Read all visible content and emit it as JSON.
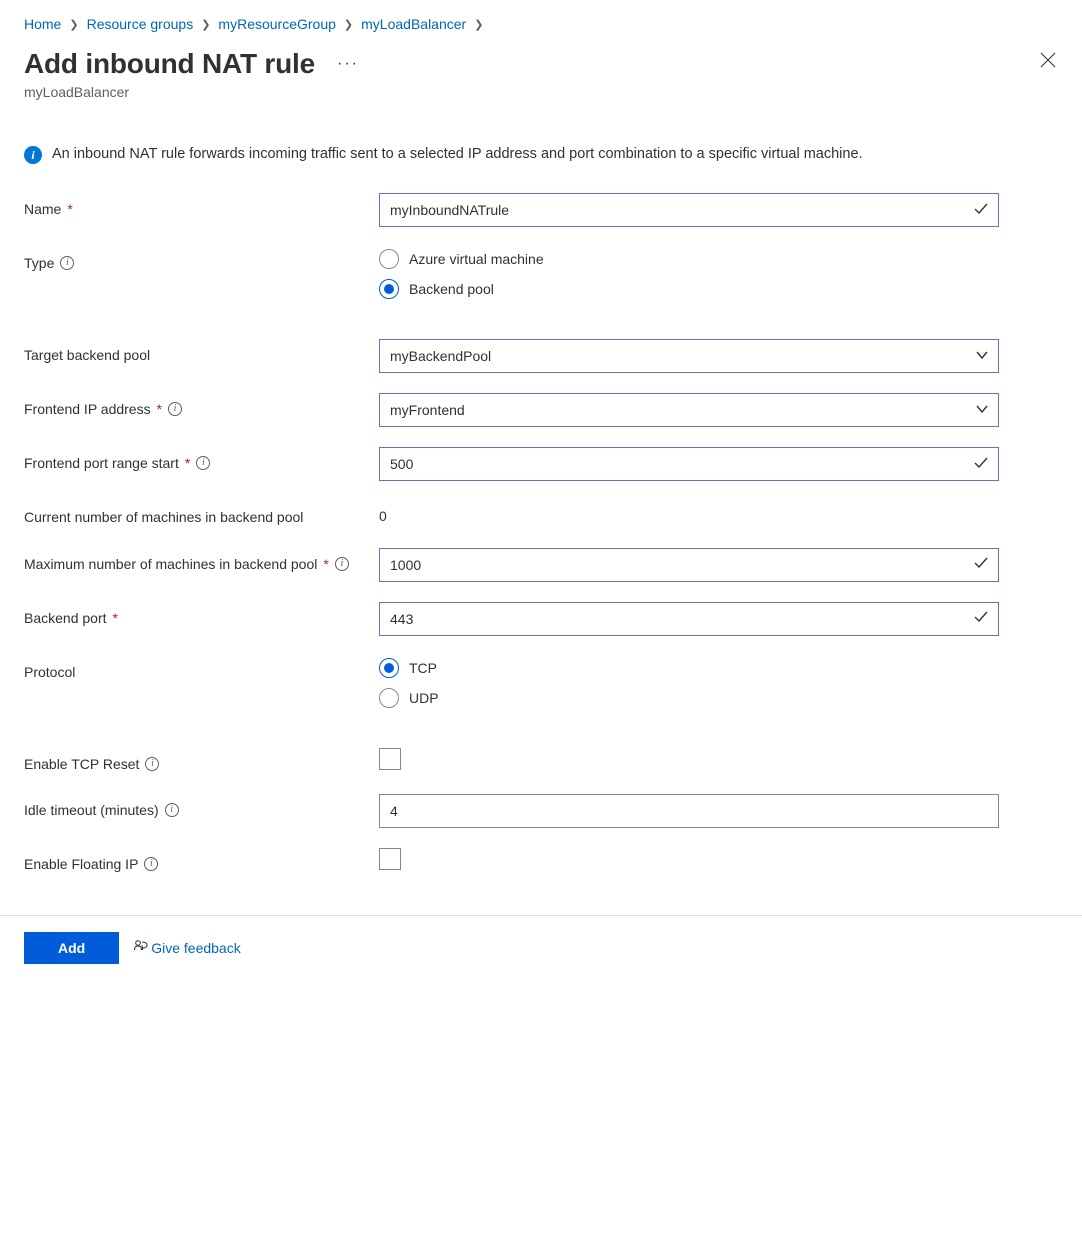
{
  "breadcrumb": {
    "items": [
      "Home",
      "Resource groups",
      "myResourceGroup",
      "myLoadBalancer"
    ]
  },
  "header": {
    "title": "Add inbound NAT rule",
    "subtitle": "myLoadBalancer"
  },
  "info": {
    "text": "An inbound NAT rule forwards incoming traffic sent to a selected IP address and port combination to a specific virtual machine."
  },
  "form": {
    "name": {
      "label": "Name",
      "value": "myInboundNATrule"
    },
    "type": {
      "label": "Type",
      "options": [
        "Azure virtual machine",
        "Backend pool"
      ],
      "selected": 1
    },
    "targetBackendPool": {
      "label": "Target backend pool",
      "value": "myBackendPool"
    },
    "frontendIp": {
      "label": "Frontend IP address",
      "value": "myFrontend"
    },
    "frontendPortStart": {
      "label": "Frontend port range start",
      "value": "500"
    },
    "currentMachines": {
      "label": "Current number of machines in backend pool",
      "value": "0"
    },
    "maxMachines": {
      "label": "Maximum number of machines in backend pool",
      "value": "1000"
    },
    "backendPort": {
      "label": "Backend port",
      "value": "443"
    },
    "protocol": {
      "label": "Protocol",
      "options": [
        "TCP",
        "UDP"
      ],
      "selected": 0
    },
    "enableTcpReset": {
      "label": "Enable TCP Reset",
      "value": false
    },
    "idleTimeout": {
      "label": "Idle timeout (minutes)",
      "value": "4"
    },
    "enableFloatingIp": {
      "label": "Enable Floating IP",
      "value": false
    }
  },
  "footer": {
    "addLabel": "Add",
    "feedbackLabel": "Give feedback"
  }
}
